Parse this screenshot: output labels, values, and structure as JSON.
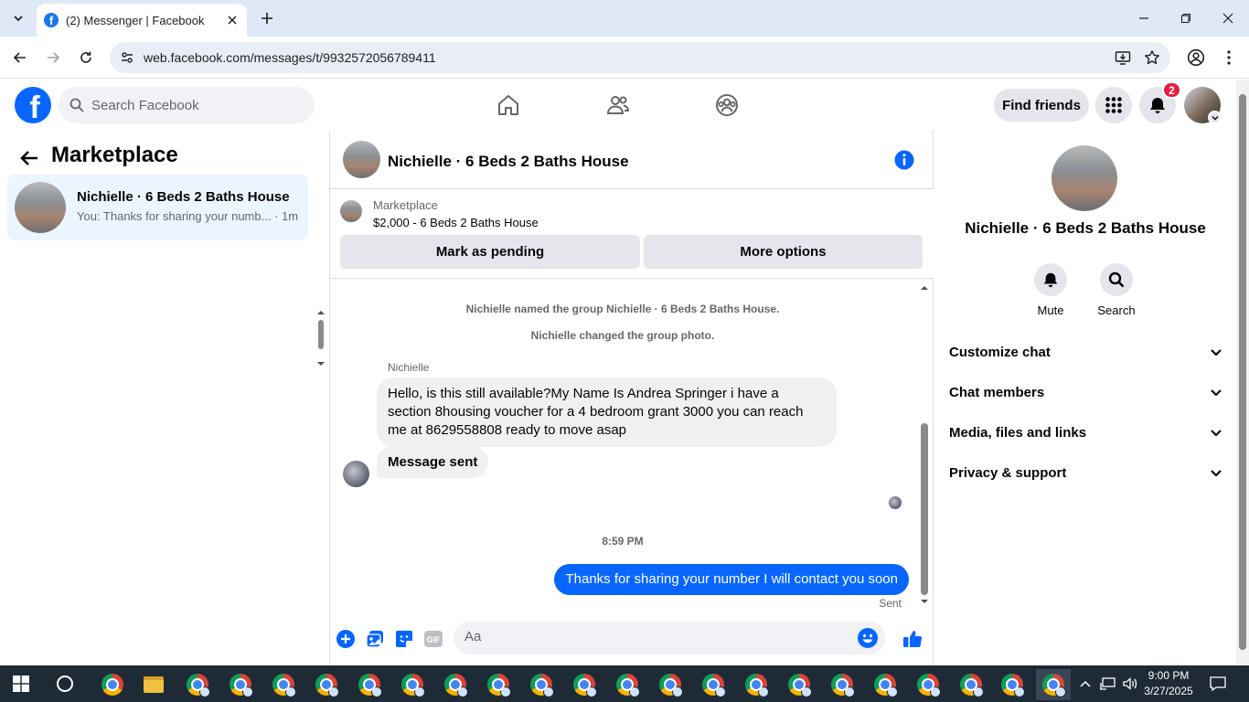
{
  "browser": {
    "tab_title": "(2) Messenger | Facebook",
    "url": "web.facebook.com/messages/t/9932572056789411"
  },
  "fb_nav": {
    "logo_letter": "f",
    "search_placeholder": "Search Facebook",
    "find_friends": "Find friends",
    "notification_count": "2"
  },
  "left_panel": {
    "title": "Marketplace",
    "conversations": [
      {
        "name": "Nichielle · 6 Beds 2 Baths House",
        "preview": "You: Thanks for sharing your numb... · 1m"
      }
    ]
  },
  "chat": {
    "header_name": "Nichielle · 6 Beds 2 Baths House",
    "listing_label": "Marketplace",
    "listing_price": "$2,000 - 6 Beds 2 Baths House",
    "mark_pending": "Mark as pending",
    "more_options": "More options",
    "system_messages": [
      "Nichielle named the group Nichielle · 6 Beds 2 Baths House.",
      "Nichielle changed the group photo."
    ],
    "sender_name": "Nichielle",
    "incoming_message": "Hello, is this still available?My Name Is Andrea Springer i have a section 8housing voucher for a 4 bedroom grant 3000 you can reach me at 8629558808 ready to move asap",
    "incoming_status": "Message sent",
    "timestamp": "8:59 PM",
    "outgoing_message": "Thanks for sharing your number I will contact you soon",
    "outgoing_status": "Sent",
    "composer_placeholder": "Aa"
  },
  "right_panel": {
    "name": "Nichielle · 6 Beds 2 Baths House",
    "actions": [
      "Mute",
      "Search"
    ],
    "sections": [
      "Customize chat",
      "Chat members",
      "Media, files and links",
      "Privacy & support"
    ]
  },
  "taskbar": {
    "time": "9:00 PM",
    "date": "3/27/2025"
  },
  "colors": {
    "fb_blue": "#0866ff",
    "selected_bg": "#ebf5ff",
    "badge_red": "#e41e3f",
    "taskbar": "#1f2a37"
  }
}
